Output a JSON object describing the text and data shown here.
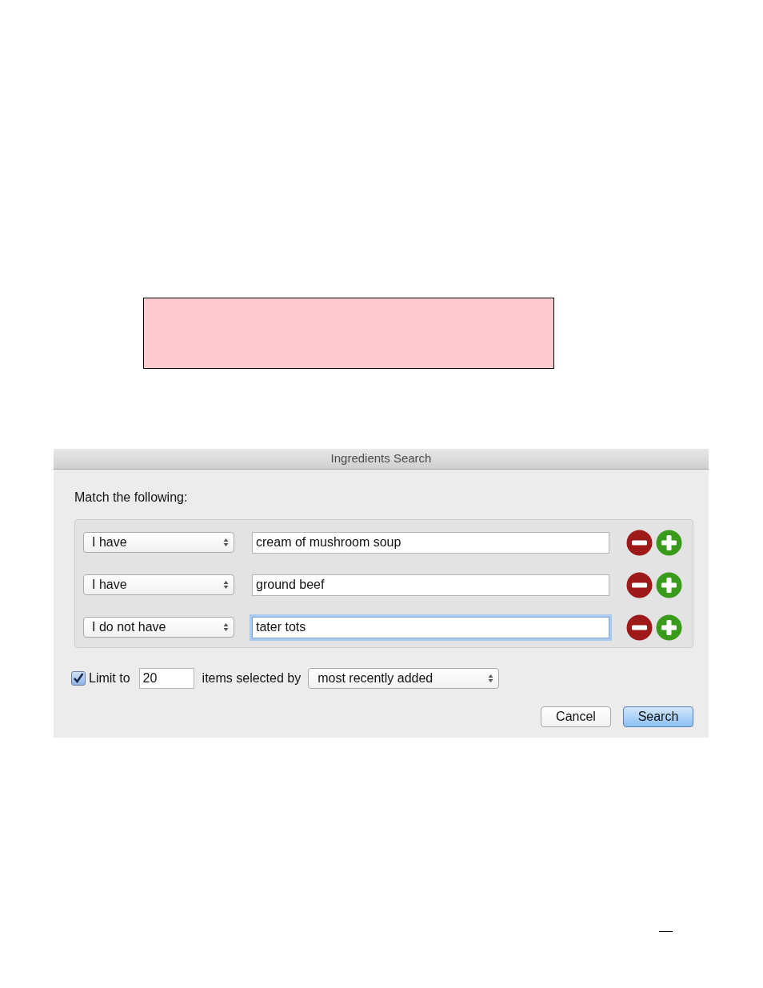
{
  "dialog": {
    "title": "Ingredients Search",
    "heading": "Match the following:",
    "rules": [
      {
        "condition": "I have",
        "ingredient": "cream of mushroom soup",
        "focused": false
      },
      {
        "condition": "I have",
        "ingredient": "ground beef",
        "focused": false
      },
      {
        "condition": "I do not have",
        "ingredient": "tater tots",
        "focused": true
      }
    ],
    "limit": {
      "checked": true,
      "label": "Limit to",
      "value": "20",
      "between": "items selected by",
      "order": "most recently added"
    },
    "buttons": [
      {
        "label": "Cancel",
        "default": false
      },
      {
        "label": "Search",
        "default": true
      }
    ]
  }
}
